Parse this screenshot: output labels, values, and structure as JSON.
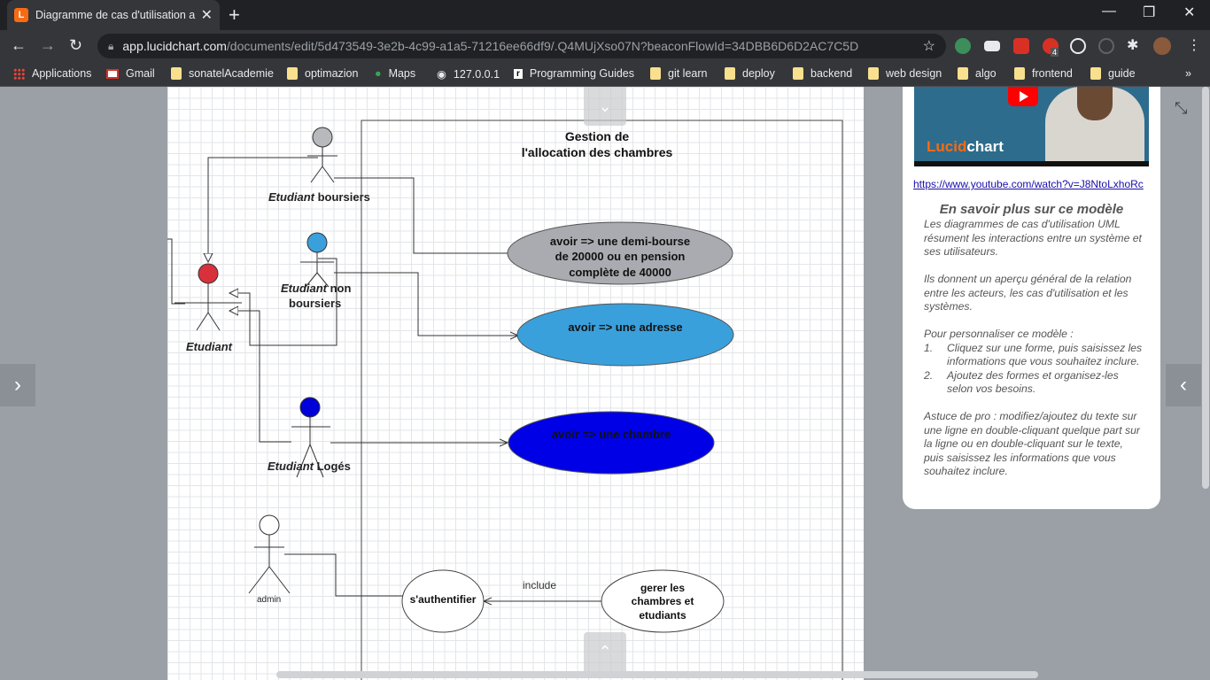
{
  "browser": {
    "tab_title": "Diagramme de cas d'utilisation al",
    "favicon_letter": "L",
    "url_host": "app.lucidchart.com",
    "url_path": "/documents/edit/5d473549-3e2b-4c99-a1a5-71216ee66df9/.Q4MUjXso07N?beaconFlowId=34DBB6D6D2AC7C5D",
    "bookmarks": [
      "Applications",
      "Gmail",
      "sonatelAcademie",
      "optimazion",
      "Maps",
      "127.0.0.1",
      "Programming Guides",
      "git learn",
      "deploy",
      "backend",
      "web design",
      "algo",
      "frontend",
      "guide"
    ],
    "ext_badge": "4"
  },
  "diagram": {
    "system_title_1": "Gestion de",
    "system_title_2": "l'allocation des chambres",
    "actors": {
      "boursiers_it": "Etudiant",
      "boursiers_rest": " boursiers",
      "non_boursiers_it": "Etudiant",
      "non_boursiers_rest": " non",
      "non_boursiers_line2": "boursiers",
      "etudiant": "Etudiant",
      "loges_it": "Etudiant",
      "loges_rest": " Logés",
      "admin": "admin"
    },
    "usecases": {
      "demi_bourse_1": "avoir => une demi-bourse",
      "demi_bourse_2": "de 20000 ou en pension",
      "demi_bourse_3": "complète de 40000",
      "adresse": "avoir => une adresse",
      "chambre": "avoir => une chambre",
      "auth": "s'authentifier",
      "gerer_1": "gerer les",
      "gerer_2": "chambres et",
      "gerer_3": "etudiants"
    },
    "include_label": "include",
    "colors": {
      "demi_bourse": "#a9abb0",
      "adresse": "#3aa0dc",
      "chambre": "#0000e6",
      "actor_boursiers": "#b8b9bd",
      "actor_non_boursiers": "#3aa0dc",
      "actor_etudiant": "#d9313b",
      "actor_loges": "#0000d8"
    }
  },
  "panel": {
    "youtube_link": "https://www.youtube.com/watch?v=J8NtoLxhoRc",
    "heading": "En savoir plus sur ce modèle",
    "para1": "Les diagrammes de cas d'utilisation UML résument les interactions entre un système et ses utilisateurs.",
    "para2": "Ils donnent un aperçu général de la relation entre les acteurs, les cas d'utilisation et les systèmes.",
    "para3": "Pour personnaliser ce modèle :",
    "step1_num": "1.",
    "step1": "Cliquez sur une forme, puis saisissez les informations que vous souhaitez inclure.",
    "step2_num": "2.",
    "step2": "Ajoutez des formes et organisez-les selon vos besoins.",
    "para4": "Astuce de pro : modifiez/ajoutez du texte sur une ligne en double-cliquant quelque part sur la ligne ou en double-cliquant sur le texte, puis saisissez les informations que vous souhaitez inclure.",
    "video_logo_prefix": "Lucid",
    "video_logo_suffix": "chart"
  }
}
